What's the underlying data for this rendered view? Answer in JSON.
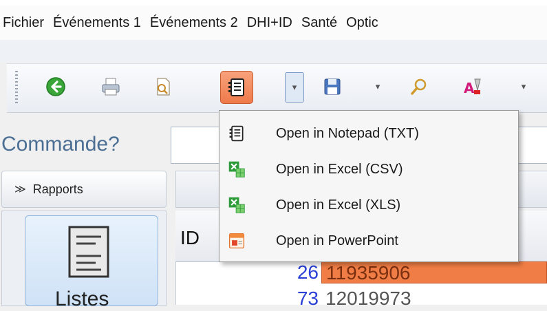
{
  "menu": {
    "items": [
      {
        "label": "Fichier"
      },
      {
        "label": "Événements 1"
      },
      {
        "label": "Événements 2"
      },
      {
        "label": "DHI+ID"
      },
      {
        "label": "Santé"
      },
      {
        "label": "Optic"
      }
    ]
  },
  "toolbar": {
    "buttons": [
      {
        "icon": "green-arrow-back-icon"
      },
      {
        "icon": "printer-icon"
      },
      {
        "icon": "document-preview-icon"
      },
      {
        "icon": "notepad-icon",
        "state": "active"
      },
      {
        "icon": "save-disk-icon"
      },
      {
        "icon": "search-magnifier-icon"
      },
      {
        "icon": "font-format-icon"
      }
    ]
  },
  "command": {
    "label": "Commande?",
    "value": ""
  },
  "sidebar": {
    "section_label": "Rapports",
    "tile_label": "Listes"
  },
  "grid": {
    "column_header": "ID",
    "rows": [
      {
        "id": "26",
        "value": "11935906",
        "selected": true
      },
      {
        "id": "73",
        "value": "12019973",
        "selected": false
      }
    ]
  },
  "dropdown": {
    "items": [
      {
        "label": "Open in Notepad (TXT)",
        "icon": "notepad-icon"
      },
      {
        "label": "Open in Excel (CSV)",
        "icon": "excel-icon"
      },
      {
        "label": "Open in Excel (XLS)",
        "icon": "excel-icon"
      },
      {
        "label": "Open in PowerPoint",
        "icon": "powerpoint-icon"
      }
    ]
  },
  "colors": {
    "accent_orange": "#ef7a4b",
    "command_text": "#4b6f94",
    "id_blue": "#2a3fd6",
    "excel_green": "#2e9b3a"
  }
}
